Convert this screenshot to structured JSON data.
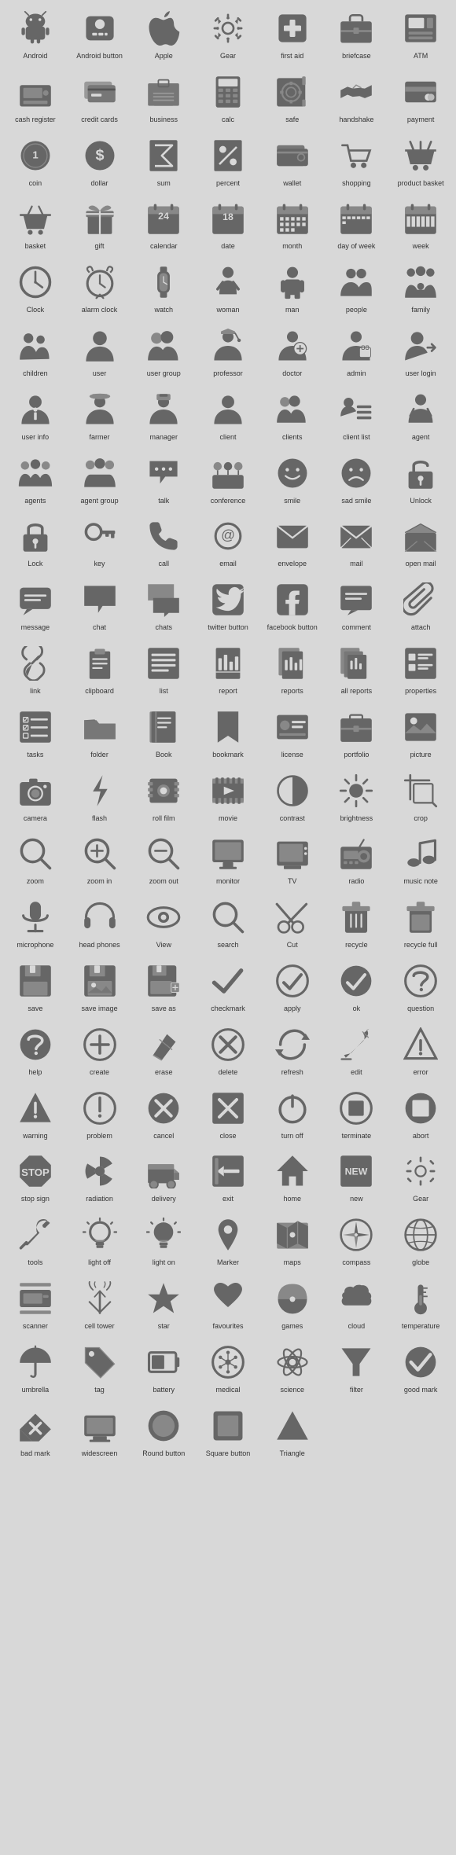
{
  "icons": [
    {
      "name": "Android",
      "shape": "android"
    },
    {
      "name": "Android button",
      "shape": "android-btn"
    },
    {
      "name": "Apple",
      "shape": "apple"
    },
    {
      "name": "Gear",
      "shape": "gear"
    },
    {
      "name": "first aid",
      "shape": "first-aid"
    },
    {
      "name": "briefcase",
      "shape": "briefcase"
    },
    {
      "name": "ATM",
      "shape": "atm"
    },
    {
      "name": "cash register",
      "shape": "cash-register"
    },
    {
      "name": "credit cards",
      "shape": "credit-cards"
    },
    {
      "name": "business",
      "shape": "business"
    },
    {
      "name": "calc",
      "shape": "calc"
    },
    {
      "name": "safe",
      "shape": "safe"
    },
    {
      "name": "handshake",
      "shape": "handshake"
    },
    {
      "name": "payment",
      "shape": "payment"
    },
    {
      "name": "coin",
      "shape": "coin"
    },
    {
      "name": "dollar",
      "shape": "dollar"
    },
    {
      "name": "sum",
      "shape": "sum"
    },
    {
      "name": "percent",
      "shape": "percent"
    },
    {
      "name": "wallet",
      "shape": "wallet"
    },
    {
      "name": "shopping",
      "shape": "shopping"
    },
    {
      "name": "product basket",
      "shape": "product-basket"
    },
    {
      "name": "basket",
      "shape": "basket"
    },
    {
      "name": "gift",
      "shape": "gift"
    },
    {
      "name": "calendar",
      "shape": "calendar"
    },
    {
      "name": "date",
      "shape": "date"
    },
    {
      "name": "month",
      "shape": "month"
    },
    {
      "name": "day of week",
      "shape": "day-of-week"
    },
    {
      "name": "week",
      "shape": "week"
    },
    {
      "name": "Clock",
      "shape": "clock"
    },
    {
      "name": "alarm clock",
      "shape": "alarm-clock"
    },
    {
      "name": "watch",
      "shape": "watch"
    },
    {
      "name": "woman",
      "shape": "woman"
    },
    {
      "name": "man",
      "shape": "man"
    },
    {
      "name": "people",
      "shape": "people"
    },
    {
      "name": "family",
      "shape": "family"
    },
    {
      "name": "children",
      "shape": "children"
    },
    {
      "name": "user",
      "shape": "user"
    },
    {
      "name": "user group",
      "shape": "user-group"
    },
    {
      "name": "professor",
      "shape": "professor"
    },
    {
      "name": "doctor",
      "shape": "doctor"
    },
    {
      "name": "admin",
      "shape": "admin"
    },
    {
      "name": "user login",
      "shape": "user-login"
    },
    {
      "name": "user info",
      "shape": "user-info"
    },
    {
      "name": "farmer",
      "shape": "farmer"
    },
    {
      "name": "manager",
      "shape": "manager"
    },
    {
      "name": "client",
      "shape": "client"
    },
    {
      "name": "clients",
      "shape": "clients"
    },
    {
      "name": "client list",
      "shape": "client-list"
    },
    {
      "name": "agent",
      "shape": "agent"
    },
    {
      "name": "agents",
      "shape": "agents"
    },
    {
      "name": "agent group",
      "shape": "agent-group"
    },
    {
      "name": "talk",
      "shape": "talk"
    },
    {
      "name": "conference",
      "shape": "conference"
    },
    {
      "name": "smile",
      "shape": "smile"
    },
    {
      "name": "sad smile",
      "shape": "sad-smile"
    },
    {
      "name": "Unlock",
      "shape": "unlock"
    },
    {
      "name": "Lock",
      "shape": "lock"
    },
    {
      "name": "key",
      "shape": "key"
    },
    {
      "name": "call",
      "shape": "call"
    },
    {
      "name": "email",
      "shape": "email"
    },
    {
      "name": "envelope",
      "shape": "envelope"
    },
    {
      "name": "mail",
      "shape": "mail"
    },
    {
      "name": "open mail",
      "shape": "open-mail"
    },
    {
      "name": "message",
      "shape": "message"
    },
    {
      "name": "chat",
      "shape": "chat"
    },
    {
      "name": "chats",
      "shape": "chats"
    },
    {
      "name": "twitter button",
      "shape": "twitter"
    },
    {
      "name": "facebook button",
      "shape": "facebook"
    },
    {
      "name": "comment",
      "shape": "comment"
    },
    {
      "name": "attach",
      "shape": "attach"
    },
    {
      "name": "link",
      "shape": "link"
    },
    {
      "name": "clipboard",
      "shape": "clipboard"
    },
    {
      "name": "list",
      "shape": "list"
    },
    {
      "name": "report",
      "shape": "report"
    },
    {
      "name": "reports",
      "shape": "reports"
    },
    {
      "name": "all reports",
      "shape": "all-reports"
    },
    {
      "name": "properties",
      "shape": "properties"
    },
    {
      "name": "tasks",
      "shape": "tasks"
    },
    {
      "name": "folder",
      "shape": "folder"
    },
    {
      "name": "Book",
      "shape": "book"
    },
    {
      "name": "bookmark",
      "shape": "bookmark"
    },
    {
      "name": "license",
      "shape": "license"
    },
    {
      "name": "portfolio",
      "shape": "portfolio"
    },
    {
      "name": "picture",
      "shape": "picture"
    },
    {
      "name": "camera",
      "shape": "camera"
    },
    {
      "name": "flash",
      "shape": "flash"
    },
    {
      "name": "roll film",
      "shape": "roll-film"
    },
    {
      "name": "movie",
      "shape": "movie"
    },
    {
      "name": "contrast",
      "shape": "contrast"
    },
    {
      "name": "brightness",
      "shape": "brightness"
    },
    {
      "name": "crop",
      "shape": "crop"
    },
    {
      "name": "zoom",
      "shape": "zoom"
    },
    {
      "name": "zoom in",
      "shape": "zoom-in"
    },
    {
      "name": "zoom out",
      "shape": "zoom-out"
    },
    {
      "name": "monitor",
      "shape": "monitor"
    },
    {
      "name": "TV",
      "shape": "tv"
    },
    {
      "name": "radio",
      "shape": "radio"
    },
    {
      "name": "music note",
      "shape": "music-note"
    },
    {
      "name": "microphone",
      "shape": "microphone"
    },
    {
      "name": "head phones",
      "shape": "headphones"
    },
    {
      "name": "View",
      "shape": "view"
    },
    {
      "name": "search",
      "shape": "search"
    },
    {
      "name": "Cut",
      "shape": "cut"
    },
    {
      "name": "recycle",
      "shape": "recycle"
    },
    {
      "name": "recycle full",
      "shape": "recycle-full"
    },
    {
      "name": "save",
      "shape": "save"
    },
    {
      "name": "save image",
      "shape": "save-image"
    },
    {
      "name": "save as",
      "shape": "save-as"
    },
    {
      "name": "checkmark",
      "shape": "checkmark"
    },
    {
      "name": "apply",
      "shape": "apply"
    },
    {
      "name": "ok",
      "shape": "ok"
    },
    {
      "name": "question",
      "shape": "question"
    },
    {
      "name": "help",
      "shape": "help"
    },
    {
      "name": "create",
      "shape": "create"
    },
    {
      "name": "erase",
      "shape": "erase"
    },
    {
      "name": "delete",
      "shape": "delete"
    },
    {
      "name": "refresh",
      "shape": "refresh"
    },
    {
      "name": "edit",
      "shape": "edit"
    },
    {
      "name": "error",
      "shape": "error"
    },
    {
      "name": "warning",
      "shape": "warning"
    },
    {
      "name": "problem",
      "shape": "problem"
    },
    {
      "name": "cancel",
      "shape": "cancel"
    },
    {
      "name": "close",
      "shape": "close"
    },
    {
      "name": "turn off",
      "shape": "turn-off"
    },
    {
      "name": "terminate",
      "shape": "terminate"
    },
    {
      "name": "abort",
      "shape": "abort"
    },
    {
      "name": "stop sign",
      "shape": "stop-sign"
    },
    {
      "name": "radiation",
      "shape": "radiation"
    },
    {
      "name": "delivery",
      "shape": "delivery"
    },
    {
      "name": "exit",
      "shape": "exit"
    },
    {
      "name": "home",
      "shape": "home"
    },
    {
      "name": "new",
      "shape": "new"
    },
    {
      "name": "Gear",
      "shape": "gear2"
    },
    {
      "name": "tools",
      "shape": "tools"
    },
    {
      "name": "light off",
      "shape": "light-off"
    },
    {
      "name": "light on",
      "shape": "light-on"
    },
    {
      "name": "Marker",
      "shape": "marker"
    },
    {
      "name": "maps",
      "shape": "maps"
    },
    {
      "name": "compass",
      "shape": "compass"
    },
    {
      "name": "globe",
      "shape": "globe"
    },
    {
      "name": "scanner",
      "shape": "scanner"
    },
    {
      "name": "cell tower",
      "shape": "cell-tower"
    },
    {
      "name": "star",
      "shape": "star"
    },
    {
      "name": "favourites",
      "shape": "favourites"
    },
    {
      "name": "games",
      "shape": "games"
    },
    {
      "name": "cloud",
      "shape": "cloud"
    },
    {
      "name": "temperature",
      "shape": "temperature"
    },
    {
      "name": "umbrella",
      "shape": "umbrella"
    },
    {
      "name": "tag",
      "shape": "tag"
    },
    {
      "name": "battery",
      "shape": "battery"
    },
    {
      "name": "medical",
      "shape": "medical"
    },
    {
      "name": "science",
      "shape": "science"
    },
    {
      "name": "filter",
      "shape": "filter"
    },
    {
      "name": "good mark",
      "shape": "good-mark"
    },
    {
      "name": "bad mark",
      "shape": "bad-mark"
    },
    {
      "name": "widescreen",
      "shape": "widescreen"
    },
    {
      "name": "Round button",
      "shape": "round-button"
    },
    {
      "name": "Square button",
      "shape": "square-button"
    },
    {
      "name": "Triangle",
      "shape": "triangle"
    }
  ]
}
